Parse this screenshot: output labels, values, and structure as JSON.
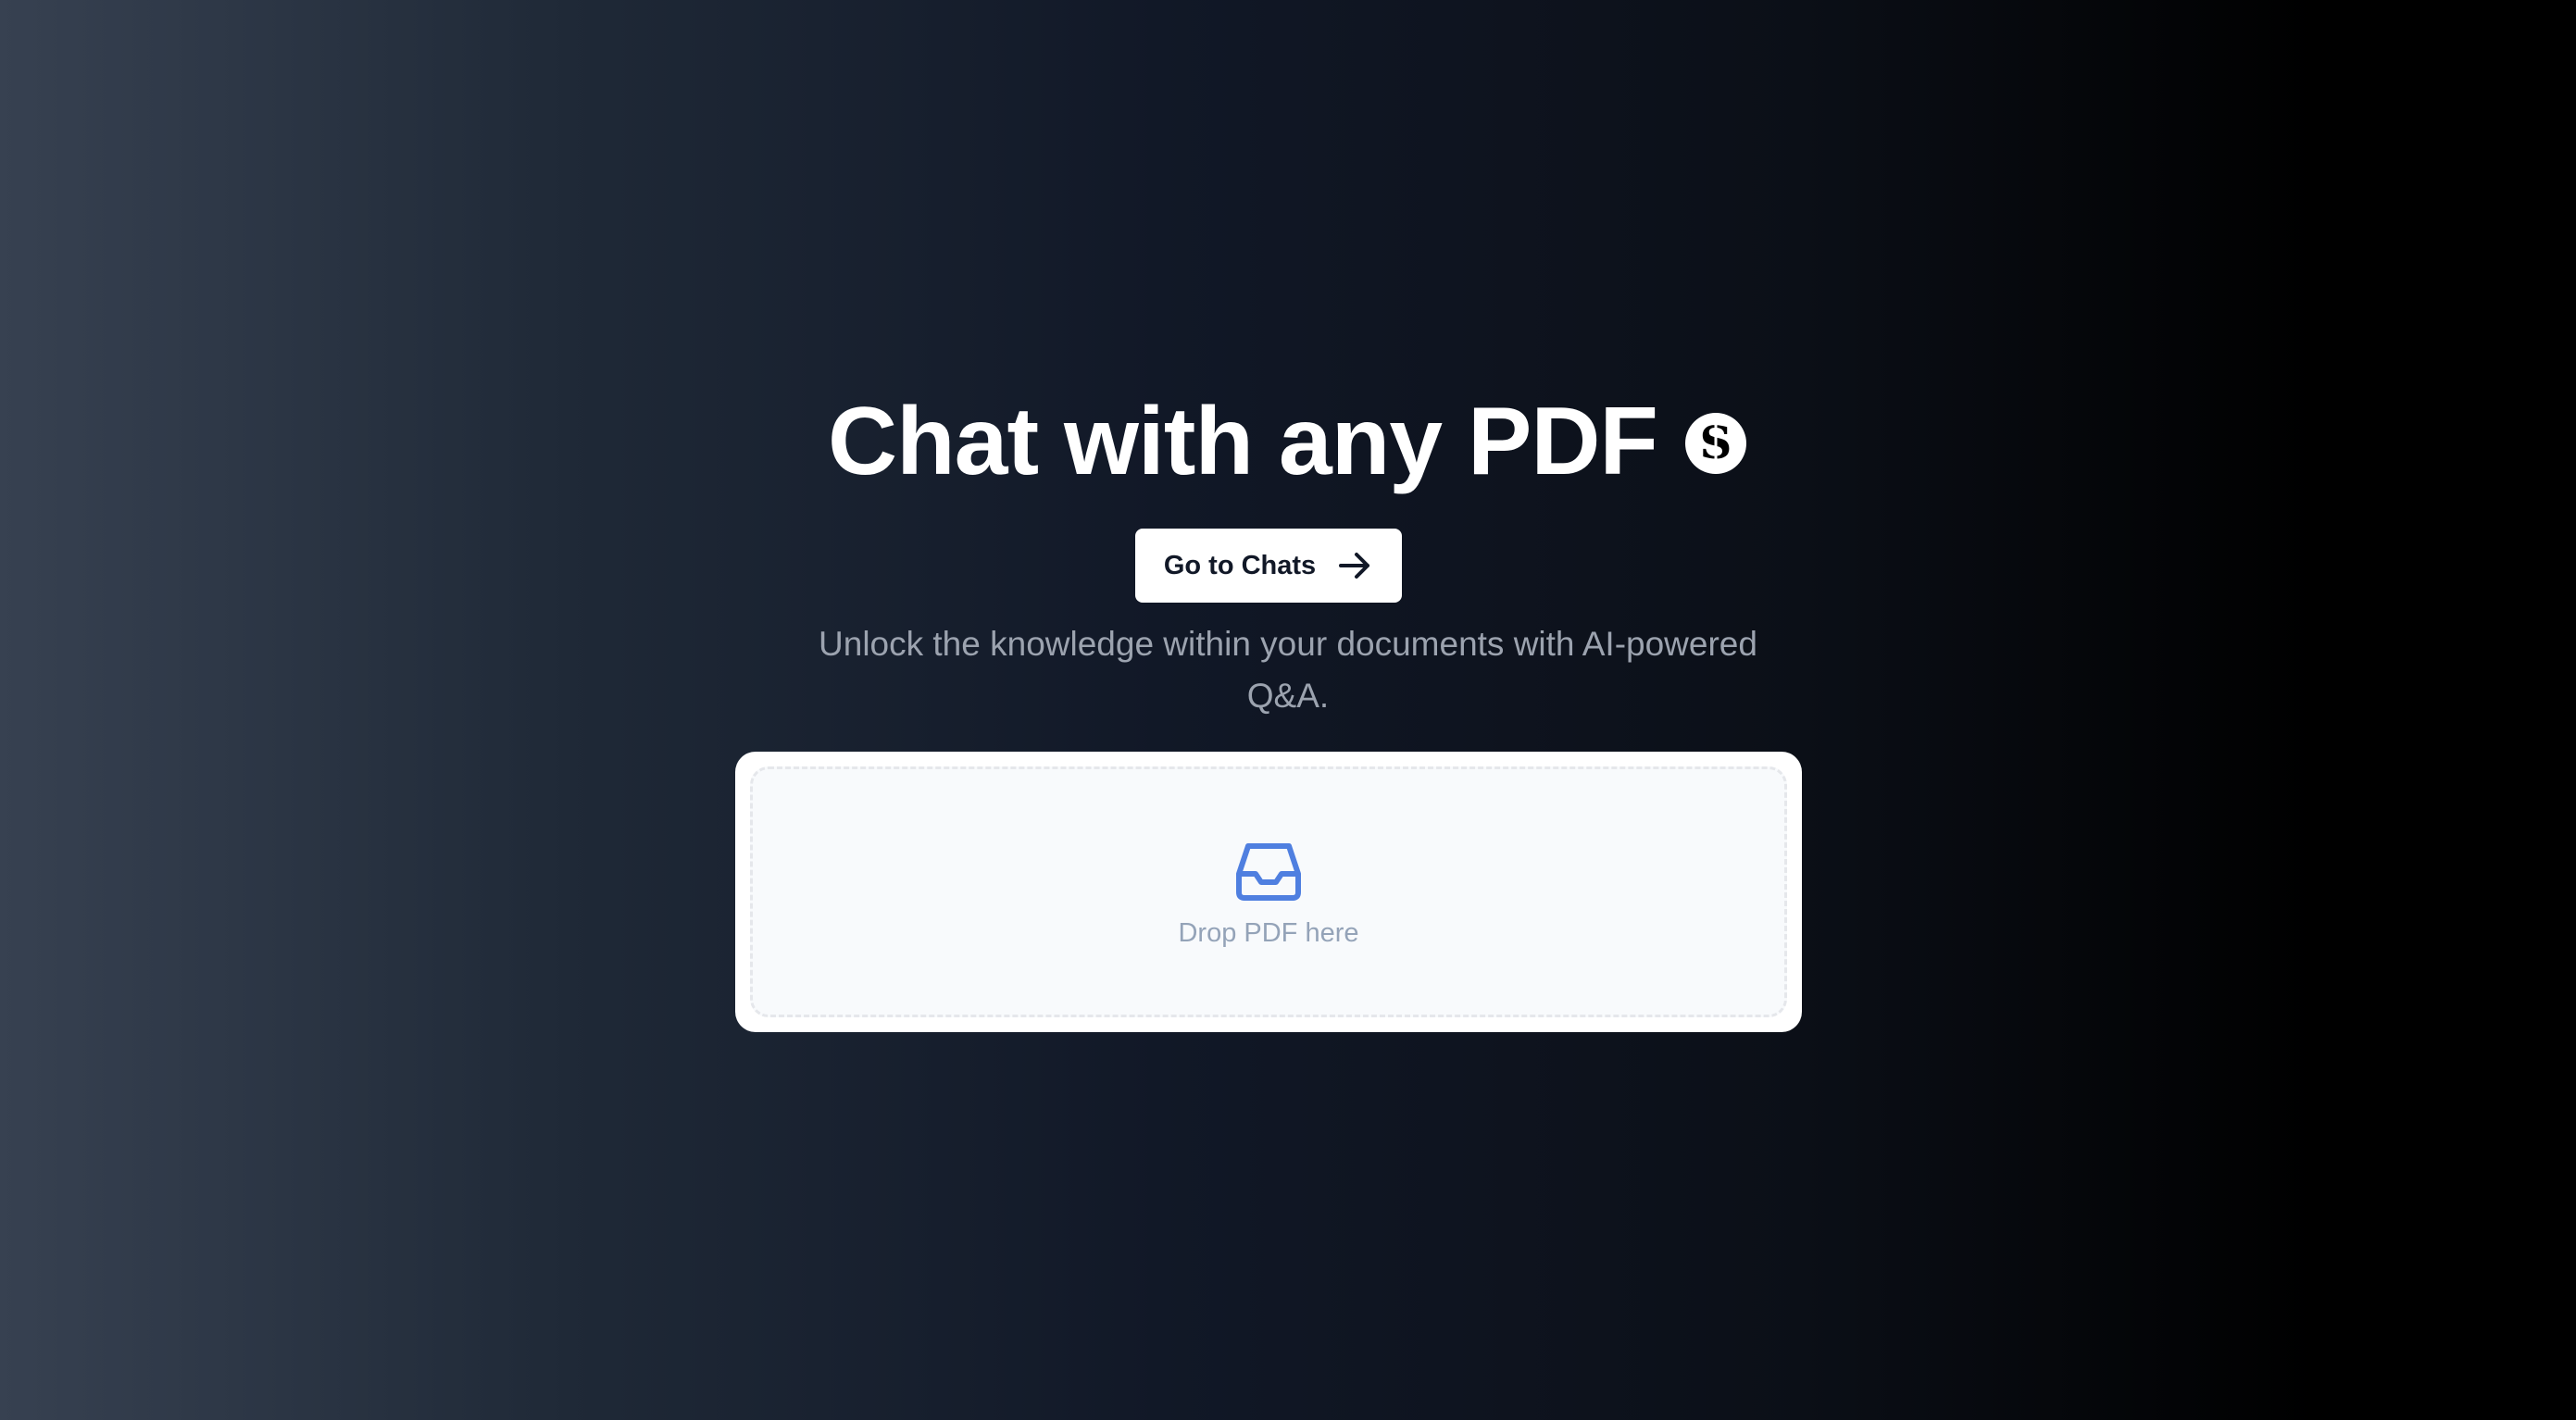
{
  "hero": {
    "title": "Chat with any PDF",
    "logo_icon": "s-logo-icon",
    "cta": {
      "label": "Go to Chats",
      "icon": "arrow-right-icon"
    },
    "subtitle_line1": "Unlock the knowledge within your documents with AI-powered",
    "subtitle_line2": "Q&A."
  },
  "upload": {
    "icon": "inbox-icon",
    "label": "Drop PDF here"
  },
  "colors": {
    "accent": "#4f7fe0",
    "text_primary": "#ffffff",
    "text_muted": "#9ca3af"
  }
}
